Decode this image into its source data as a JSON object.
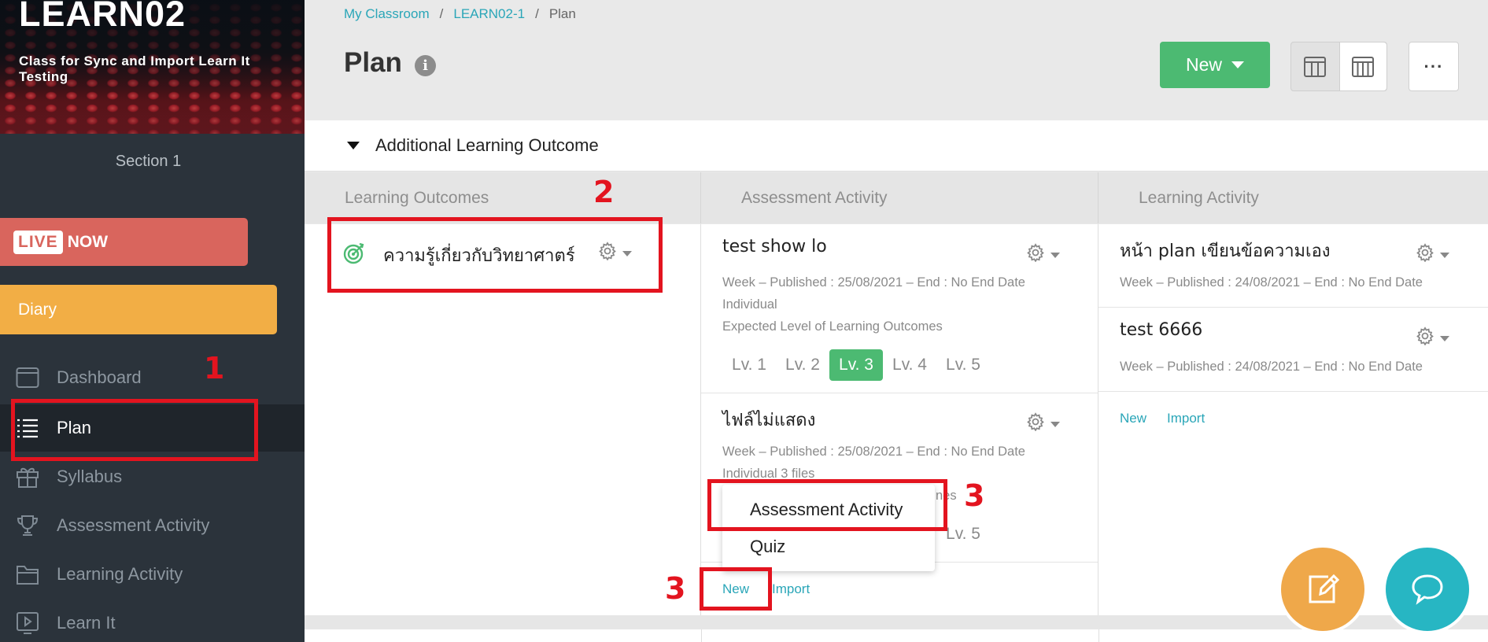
{
  "sidebar": {
    "class_code": "LEARN02",
    "class_name": "Class for Sync and Import Learn It Testing",
    "section": "Section 1",
    "live_tag": "LIVE",
    "live_now": "NOW",
    "diary": "Diary",
    "nav": [
      {
        "label": "Dashboard",
        "icon": "browser-window-icon"
      },
      {
        "label": "Plan",
        "icon": "list-icon",
        "active": true
      },
      {
        "label": "Syllabus",
        "icon": "gift-icon"
      },
      {
        "label": "Assessment Activity",
        "icon": "trophy-icon"
      },
      {
        "label": "Learning Activity",
        "icon": "folder-icon"
      },
      {
        "label": "Learn It",
        "icon": "play-screen-icon"
      }
    ]
  },
  "breadcrumb": [
    "My Classroom",
    "LEARN02-1",
    "Plan"
  ],
  "page": {
    "title": "Plan",
    "new_button": "New",
    "more": "···"
  },
  "section_header": "Additional Learning Outcome",
  "columns": {
    "learning_outcomes": "Learning Outcomes",
    "assessment_activity": "Assessment Activity",
    "learning_activity": "Learning Activity"
  },
  "outcome": {
    "title": "ความรู้เกี่ยวกับวิทยาศาตร์"
  },
  "assessments": [
    {
      "title": "test show lo",
      "meta": "Week –   Published : 25/08/2021 – End : No End Date",
      "type": "Individual",
      "expected": "Expected Level of Learning Outcomes",
      "levels": [
        "Lv. 1",
        "Lv. 2",
        "Lv. 3",
        "Lv. 4",
        "Lv. 5"
      ],
      "selected_level": 3
    },
    {
      "title": "ไฟล์ไม่แสดง",
      "meta": "Week –   Published : 25/08/2021 – End : No End Date",
      "type": "Individual 3 files",
      "expected_partial": "nes",
      "level_visible": "Lv. 5"
    }
  ],
  "assessment_links": {
    "new": "New",
    "import": "Import"
  },
  "dropdown": {
    "items": [
      "Assessment Activity",
      "Quiz"
    ]
  },
  "activities": [
    {
      "title": "หน้า plan เขียนข้อความเอง",
      "meta": "Week –   Published : 24/08/2021 – End : No End Date"
    },
    {
      "title": "test 6666",
      "meta": "Week –   Published : 24/08/2021 – End : No End Date"
    }
  ],
  "activity_links": {
    "new": "New",
    "import": "Import"
  },
  "annotations": {
    "n1": "1",
    "n2": "2",
    "n3": "3"
  },
  "colors": {
    "green": "#4cba72",
    "teal": "#2aa6b8",
    "live": "#d9655d",
    "diary": "#f2ae45",
    "annotation": "#e3141f"
  }
}
